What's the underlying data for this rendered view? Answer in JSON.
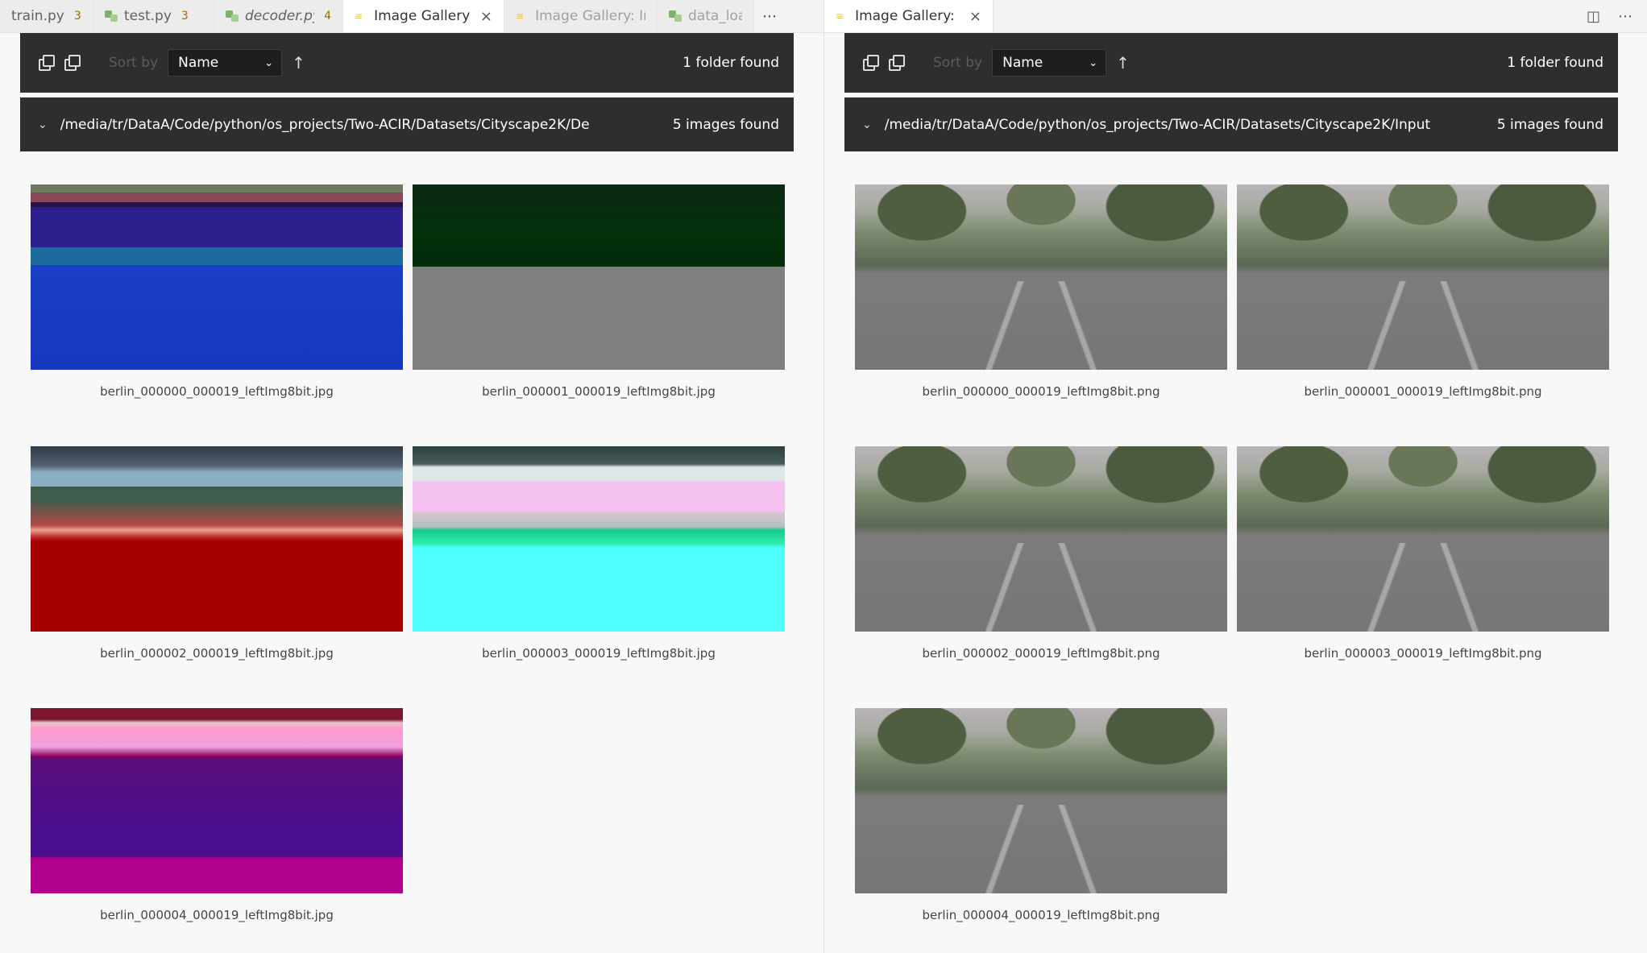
{
  "left_tabs": [
    {
      "label": "train.py",
      "badge": "3",
      "type": "py"
    },
    {
      "label": "test.py",
      "badge": "3",
      "type": "py"
    },
    {
      "label": "decoder.py",
      "badge": "4",
      "type": "py",
      "italic": true
    },
    {
      "label": "Image Gallery: De",
      "type": "gallery",
      "active": true,
      "close": "×"
    },
    {
      "label": "Image Gallery: Input_S",
      "type": "gallery",
      "dim": true
    },
    {
      "label": "data_loac",
      "type": "py",
      "dim": true
    }
  ],
  "right_tabs": [
    {
      "label": "Image Gallery: Input",
      "type": "gallery",
      "active": true,
      "close": "×"
    }
  ],
  "left_pane": {
    "sort_label": "Sort by",
    "sort_value": "Name",
    "folder_count": "1 folder found",
    "folder_path": "/media/tr/DataA/Code/python/os_projects/Two-ACIR/Datasets/Cityscape2K/De",
    "images_count": "5 images found",
    "images": [
      {
        "filename": "berlin_000000_000019_leftImg8bit.jpg",
        "style": "t-l0"
      },
      {
        "filename": "berlin_000001_000019_leftImg8bit.jpg",
        "style": "t-l1"
      },
      {
        "filename": "berlin_000002_000019_leftImg8bit.jpg",
        "style": "t-l2"
      },
      {
        "filename": "berlin_000003_000019_leftImg8bit.jpg",
        "style": "t-l3"
      },
      {
        "filename": "berlin_000004_000019_leftImg8bit.jpg",
        "style": "t-l4"
      }
    ]
  },
  "right_pane": {
    "sort_label": "Sort by",
    "sort_value": "Name",
    "folder_count": "1 folder found",
    "folder_path": "/media/tr/DataA/Code/python/os_projects/Two-ACIR/Datasets/Cityscape2K/Input",
    "images_count": "5 images found",
    "images": [
      {
        "filename": "berlin_000000_000019_leftImg8bit.png",
        "style": "t-photo"
      },
      {
        "filename": "berlin_000001_000019_leftImg8bit.png",
        "style": "t-photo"
      },
      {
        "filename": "berlin_000002_000019_leftImg8bit.png",
        "style": "t-photo"
      },
      {
        "filename": "berlin_000003_000019_leftImg8bit.png",
        "style": "t-photo"
      },
      {
        "filename": "berlin_000004_000019_leftImg8bit.png",
        "style": "t-photo"
      }
    ]
  },
  "icons": {
    "close": "×",
    "more": "⋯",
    "split": "◫",
    "sort_asc": "↑",
    "chevron_down": "⌄",
    "collapse": "⌄"
  }
}
